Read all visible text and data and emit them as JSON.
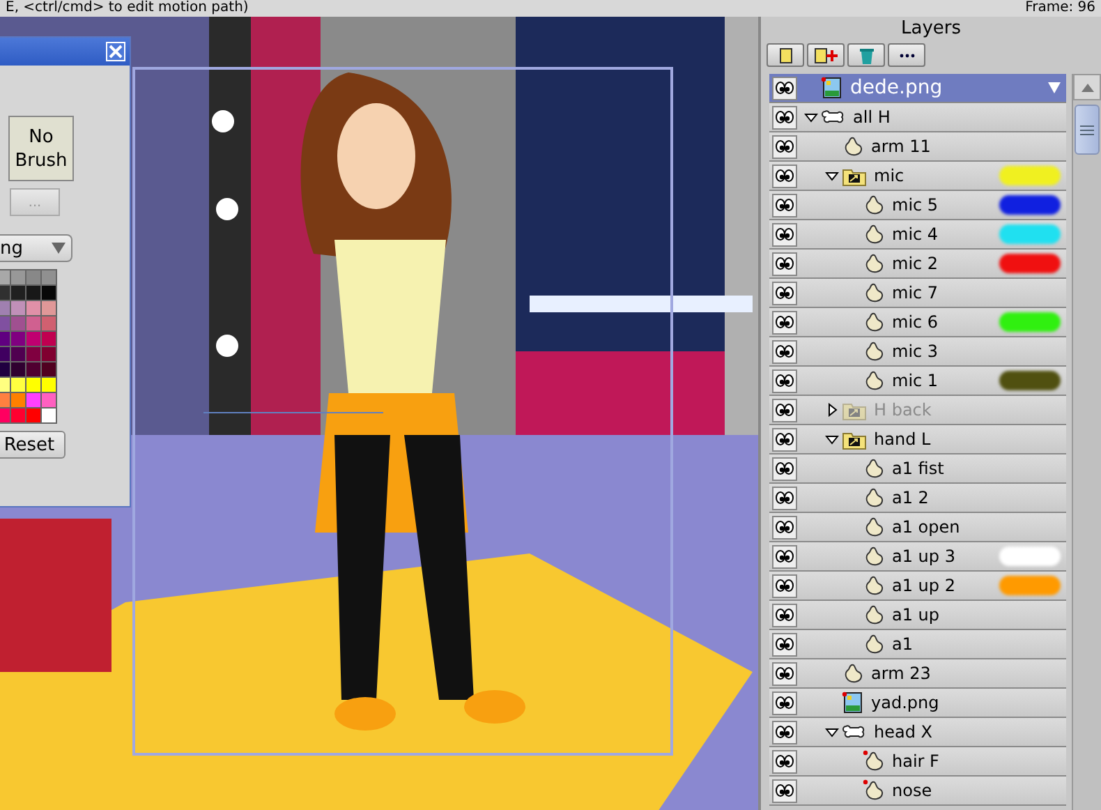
{
  "status_bar": {
    "hint": "E, <ctrl/cmd> to edit motion path)",
    "frame": "Frame: 96"
  },
  "style_panel": {
    "brush_button": "No Brush",
    "more_button": "...",
    "dropdown": "ng",
    "reset_button": "Reset",
    "palette": [
      {
        "color": "#a8a8a8"
      },
      {
        "color": "#989898"
      },
      {
        "color": "#888888"
      },
      {
        "color": "#909090"
      },
      {
        "color": "#303030"
      },
      {
        "color": "#202020"
      },
      {
        "color": "#181818"
      },
      {
        "color": "#080808"
      },
      {
        "color": "#a080b0"
      },
      {
        "color": "#c090b8"
      },
      {
        "color": "#e090a8"
      },
      {
        "color": "#e09898"
      },
      {
        "color": "#8050a0"
      },
      {
        "color": "#a05090"
      },
      {
        "color": "#d06090"
      },
      {
        "color": "#d06070"
      },
      {
        "color": "#600080"
      },
      {
        "color": "#800080"
      },
      {
        "color": "#c00070"
      },
      {
        "color": "#c00050"
      },
      {
        "color": "#400060"
      },
      {
        "color": "#500050"
      },
      {
        "color": "#800040"
      },
      {
        "color": "#800030"
      },
      {
        "color": "#200040"
      },
      {
        "color": "#300030"
      },
      {
        "color": "#500030"
      },
      {
        "color": "#500020"
      },
      {
        "color": "#ffff80"
      },
      {
        "color": "#ffff40"
      },
      {
        "color": "#ffff00"
      },
      {
        "color": "#ffff00"
      },
      {
        "color": "#ff8040"
      },
      {
        "color": "#ff8000"
      },
      {
        "color": "#ff40ff"
      },
      {
        "color": "#ff60c0"
      },
      {
        "color": "#ff0060"
      },
      {
        "color": "#ff0030"
      },
      {
        "color": "#ff0000"
      },
      {
        "color": "#ffffff"
      }
    ]
  },
  "layers_panel": {
    "title": "Layers",
    "layers": [
      {
        "name": "dede.png",
        "kind": "image",
        "selected": true,
        "hidden": false,
        "keyed": true
      },
      {
        "name": "all H",
        "kind": "bone",
        "selected": false,
        "hidden": false,
        "keyed": false,
        "expanded": true,
        "children": [
          {
            "name": "arm 11",
            "kind": "vector",
            "selected": false,
            "hidden": false,
            "keyed": false
          },
          {
            "name": "mic",
            "kind": "switch",
            "selected": false,
            "hidden": false,
            "keyed": false,
            "expanded": true,
            "color": "#f0f020",
            "children": [
              {
                "name": "mic 5",
                "kind": "vector",
                "selected": false,
                "hidden": false,
                "keyed": false,
                "color": "#1020e0"
              },
              {
                "name": "mic 4",
                "kind": "vector",
                "selected": false,
                "hidden": false,
                "keyed": false,
                "color": "#20e0f0"
              },
              {
                "name": "mic 2",
                "kind": "vector",
                "selected": false,
                "hidden": false,
                "keyed": false,
                "color": "#f01010"
              },
              {
                "name": "mic 7",
                "kind": "vector",
                "selected": false,
                "hidden": false,
                "keyed": false
              },
              {
                "name": "mic 6",
                "kind": "vector",
                "selected": false,
                "hidden": false,
                "keyed": false,
                "color": "#30f010"
              },
              {
                "name": "mic 3",
                "kind": "vector",
                "selected": false,
                "hidden": false,
                "keyed": false
              },
              {
                "name": "mic 1",
                "kind": "vector",
                "selected": false,
                "hidden": false,
                "keyed": false,
                "color": "#505010"
              }
            ]
          },
          {
            "name": "H back",
            "kind": "switch",
            "selected": false,
            "hidden": true,
            "keyed": false,
            "expanded": false
          },
          {
            "name": "hand L",
            "kind": "switch",
            "selected": false,
            "hidden": false,
            "keyed": false,
            "expanded": true,
            "children": [
              {
                "name": "a1 fist",
                "kind": "vector",
                "selected": false,
                "hidden": false,
                "keyed": false
              },
              {
                "name": "a1 2",
                "kind": "vector",
                "selected": false,
                "hidden": false,
                "keyed": false
              },
              {
                "name": "a1 open",
                "kind": "vector",
                "selected": false,
                "hidden": false,
                "keyed": false
              },
              {
                "name": "a1 up 3",
                "kind": "vector",
                "selected": false,
                "hidden": false,
                "keyed": false,
                "color": "#ffffff"
              },
              {
                "name": "a1 up 2",
                "kind": "vector",
                "selected": false,
                "hidden": false,
                "keyed": false,
                "color": "#ff9a00"
              },
              {
                "name": "a1 up",
                "kind": "vector",
                "selected": false,
                "hidden": false,
                "keyed": false
              },
              {
                "name": "a1",
                "kind": "vector",
                "selected": false,
                "hidden": false,
                "keyed": false
              }
            ]
          },
          {
            "name": "arm 23",
            "kind": "vector",
            "selected": false,
            "hidden": false,
            "keyed": false
          },
          {
            "name": "yad.png",
            "kind": "image",
            "selected": false,
            "hidden": false,
            "keyed": true
          },
          {
            "name": "head X",
            "kind": "bone",
            "selected": false,
            "hidden": false,
            "keyed": false,
            "expanded": true,
            "children": [
              {
                "name": "hair F",
                "kind": "vector",
                "selected": false,
                "hidden": false,
                "keyed": true
              },
              {
                "name": "nose",
                "kind": "vector",
                "selected": false,
                "hidden": false,
                "keyed": true
              }
            ]
          }
        ]
      }
    ]
  }
}
